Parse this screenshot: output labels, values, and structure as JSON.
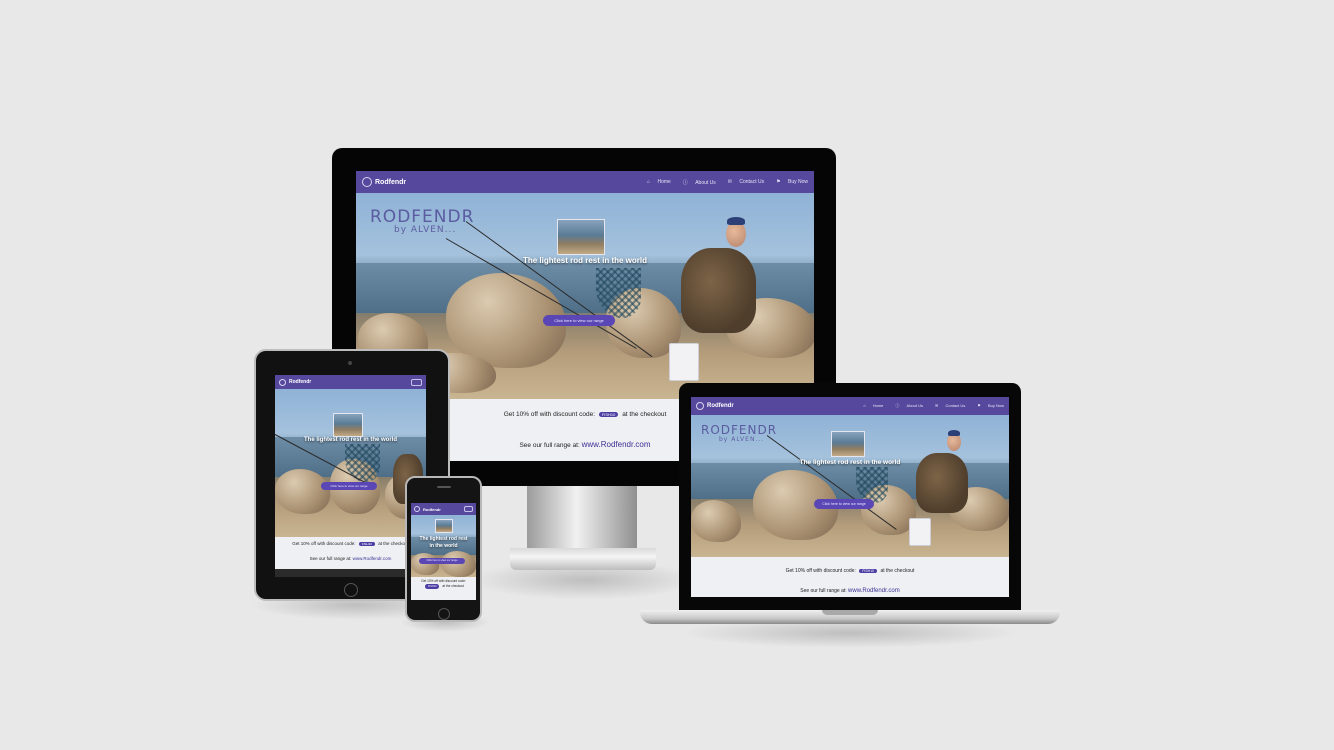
{
  "site": {
    "brand": "Rodfendr",
    "nav_links": [
      "Home",
      "About Us",
      "Contact Us",
      "Buy Now"
    ],
    "watermark_main": "RODFENDR",
    "watermark_sub": "by ALVEN...",
    "tagline": "The lightest rod rest in the world",
    "tablet_tagline": "The lightest rod rest in the world",
    "phone_tagline_1": "The lightest rod rest",
    "phone_tagline_2": "in the world",
    "shop_button": "Click here to view our range",
    "promo_prefix": "Get 10% off with discount code:",
    "promo_code": "FISH10",
    "promo_suffix": "at the checkout",
    "range_prefix": "See our full range at:",
    "range_link": "www.Rodfendr.com"
  },
  "colors": {
    "nav": "#56489d",
    "accent": "#5a47b5",
    "background": "#e8e8e8"
  },
  "icons": [
    "home-icon",
    "info-icon",
    "envelope-icon",
    "flag-icon",
    "fishing-logo-icon",
    "hamburger-menu-icon"
  ]
}
